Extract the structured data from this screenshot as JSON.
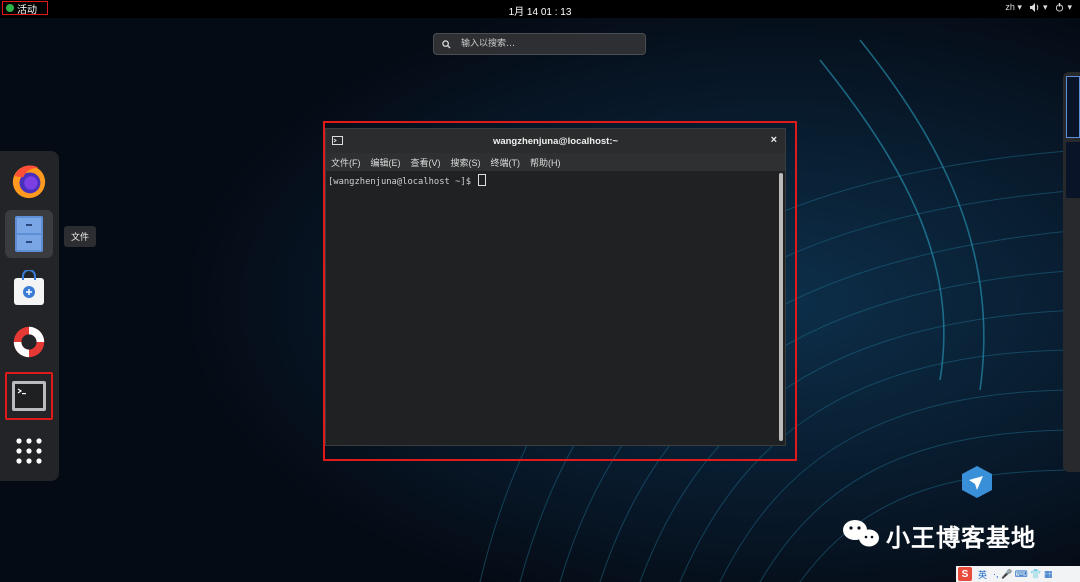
{
  "topbar": {
    "activities_label": "活动",
    "clock": "1月 14  01 : 13",
    "lang": "zh ▾",
    "volume": "◀)▾",
    "power": "⏻▾"
  },
  "search": {
    "placeholder": "输入以搜索…"
  },
  "dock": {
    "items": [
      {
        "name": "firefox",
        "icon": "firefox-icon"
      },
      {
        "name": "files",
        "icon": "files-cabinet-icon"
      },
      {
        "name": "software",
        "icon": "software-bag-icon"
      },
      {
        "name": "help",
        "icon": "lifebuoy-icon"
      },
      {
        "name": "terminal",
        "icon": "terminal-icon"
      },
      {
        "name": "show-apps",
        "icon": "app-grid-icon"
      }
    ],
    "tooltip": "文件"
  },
  "terminal": {
    "title": "wangzhenjuna@localhost:~",
    "close": "×",
    "menu": [
      "文件(F)",
      "编辑(E)",
      "查看(V)",
      "搜索(S)",
      "终端(T)",
      "帮助(H)"
    ],
    "prompt": "[wangzhenjuna@localhost ~]$ "
  },
  "watermark": {
    "text": "小王博客基地"
  },
  "ime": {
    "logo": "S",
    "lang": "英",
    "items": "·, 🎤 ⌨ 👕 ▦"
  },
  "colors": {
    "highlight": "#e01a1a",
    "dock_bg": "#232427",
    "term_bg": "#1f2122"
  }
}
